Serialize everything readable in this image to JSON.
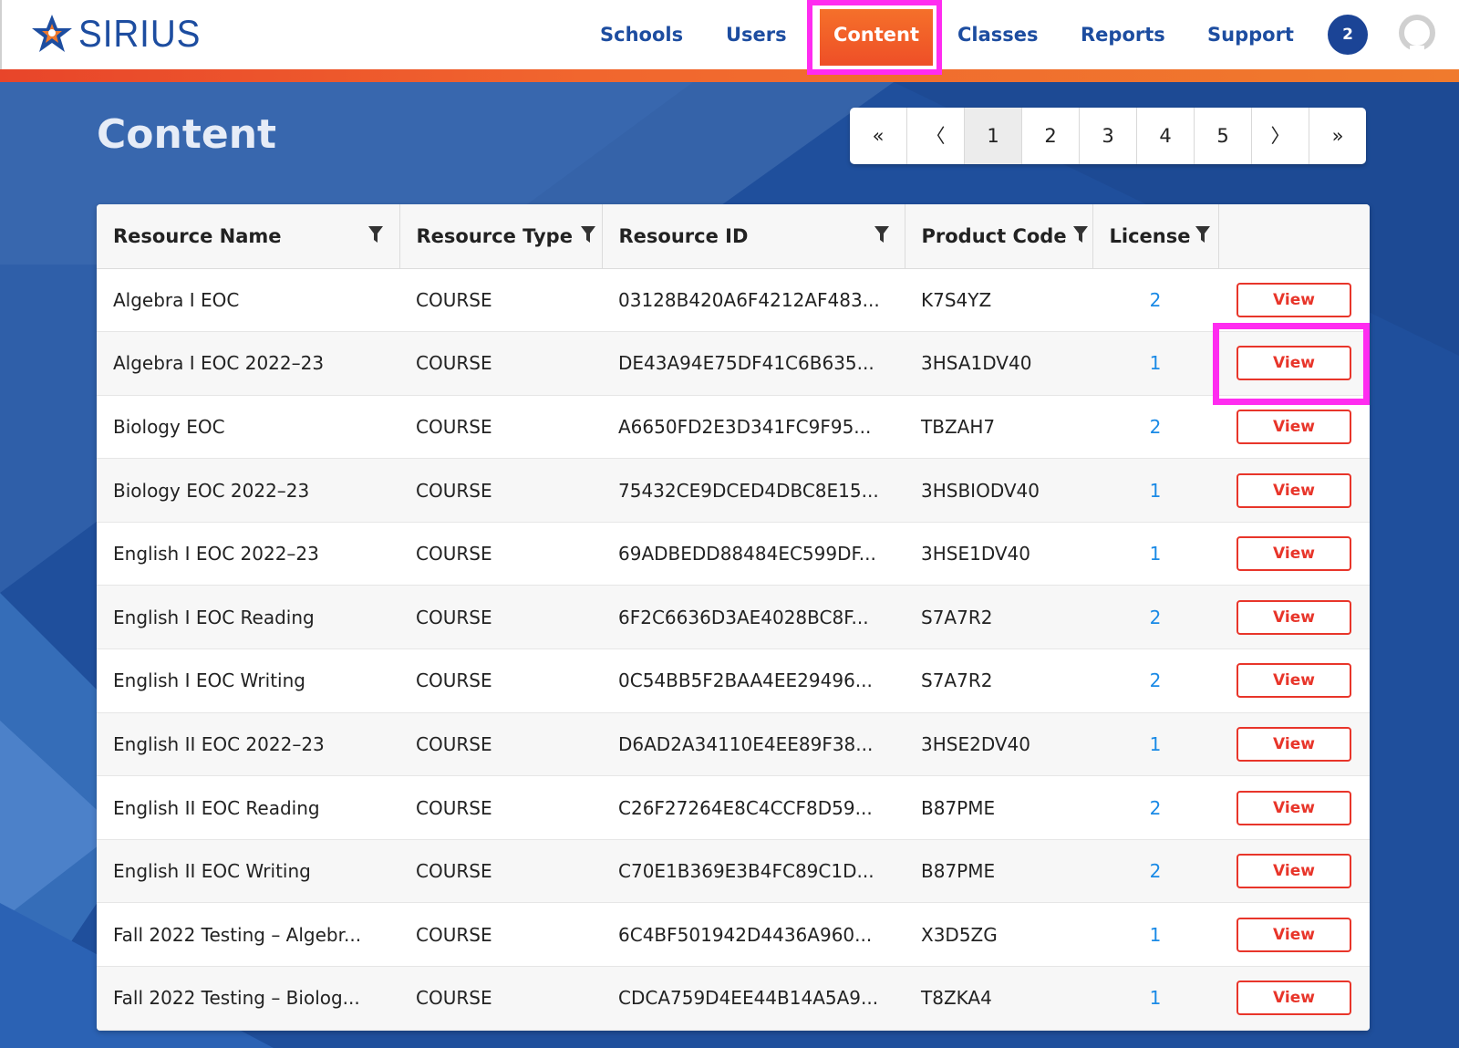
{
  "app": {
    "logo_text": "SIRIUS",
    "colors": {
      "brand_blue": "#1d4da0",
      "accent_orange": "#f07a2d",
      "highlight": "#ff2cf0",
      "action_red": "#e8352a",
      "license_blue": "#1a8ae6"
    }
  },
  "nav": {
    "items": [
      {
        "label": "Schools"
      },
      {
        "label": "Users"
      },
      {
        "label": "Content",
        "active": true
      },
      {
        "label": "Classes"
      },
      {
        "label": "Reports"
      },
      {
        "label": "Support"
      }
    ],
    "notification_count": "2",
    "avatar_icon": "user-avatar-icon"
  },
  "page": {
    "title": "Content"
  },
  "pagination": {
    "first": "«",
    "prev": "〈",
    "next": "〉",
    "last": "»",
    "pages": [
      "1",
      "2",
      "3",
      "4",
      "5"
    ],
    "current": "1"
  },
  "table": {
    "columns": [
      "Resource Name",
      "Resource Type",
      "Resource ID",
      "Product Code",
      "License"
    ],
    "action_label": "View",
    "rows": [
      {
        "name": "Algebra I EOC",
        "type": "COURSE",
        "id": "03128B420A6F4212AF483...",
        "code": "K7S4YZ",
        "license": "2"
      },
      {
        "name": "Algebra I EOC 2022–23",
        "type": "COURSE",
        "id": "DE43A94E75DF41C6B635...",
        "code": "3HSA1DV40",
        "license": "1"
      },
      {
        "name": "Biology EOC",
        "type": "COURSE",
        "id": "A6650FD2E3D341FC9F95...",
        "code": "TBZAH7",
        "license": "2"
      },
      {
        "name": "Biology EOC 2022–23",
        "type": "COURSE",
        "id": "75432CE9DCED4DBC8E15...",
        "code": "3HSBIODV40",
        "license": "1"
      },
      {
        "name": "English I EOC 2022–23",
        "type": "COURSE",
        "id": "69ADBEDD88484EC599DF...",
        "code": "3HSE1DV40",
        "license": "1"
      },
      {
        "name": "English I EOC Reading",
        "type": "COURSE",
        "id": "6F2C6636D3AE4028BC8F...",
        "code": "S7A7R2",
        "license": "2"
      },
      {
        "name": "English I EOC Writing",
        "type": "COURSE",
        "id": "0C54BB5F2BAA4EE29496...",
        "code": "S7A7R2",
        "license": "2"
      },
      {
        "name": "English II EOC 2022–23",
        "type": "COURSE",
        "id": "D6AD2A34110E4EE89F38...",
        "code": "3HSE2DV40",
        "license": "1"
      },
      {
        "name": "English II EOC Reading",
        "type": "COURSE",
        "id": "C26F27264E8C4CCF8D59...",
        "code": "B87PME",
        "license": "2"
      },
      {
        "name": "English II EOC Writing",
        "type": "COURSE",
        "id": "C70E1B369E3B4FC89C1D...",
        "code": "B87PME",
        "license": "2"
      },
      {
        "name": "Fall 2022 Testing – Algebr...",
        "type": "COURSE",
        "id": "6C4BF501942D4436A960...",
        "code": "X3D5ZG",
        "license": "1"
      },
      {
        "name": "Fall 2022 Testing – Biolog...",
        "type": "COURSE",
        "id": "CDCA759D4EE44B14A5A9...",
        "code": "T8ZKA4",
        "license": "1"
      }
    ]
  }
}
